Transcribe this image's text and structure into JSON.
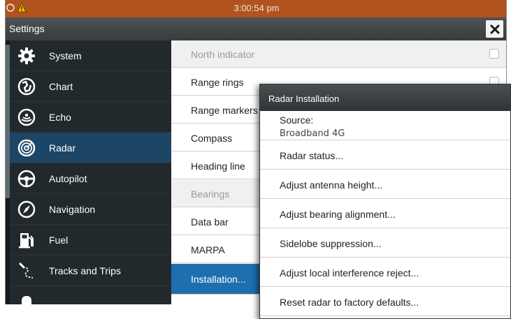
{
  "status_bar": {
    "time": "3:00:54 pm",
    "color": "#b0531f"
  },
  "title_bar": {
    "title": "Settings",
    "close_icon": "close-icon"
  },
  "sidebar": {
    "items": [
      {
        "label": "System",
        "icon": "gear-icon"
      },
      {
        "label": "Chart",
        "icon": "chart-icon"
      },
      {
        "label": "Echo",
        "icon": "echo-icon"
      },
      {
        "label": "Radar",
        "icon": "radar-icon",
        "active": true
      },
      {
        "label": "Autopilot",
        "icon": "autopilot-icon"
      },
      {
        "label": "Navigation",
        "icon": "compass-icon"
      },
      {
        "label": "Fuel",
        "icon": "fuel-icon"
      },
      {
        "label": "Tracks and Trips",
        "icon": "tracks-icon"
      },
      {
        "label": "",
        "icon": "alarms-icon"
      }
    ]
  },
  "options": {
    "items": [
      {
        "label": "North indicator",
        "disabled": true,
        "checkbox": true
      },
      {
        "label": "Range rings"
      },
      {
        "label": "Range markers"
      },
      {
        "label": "Compass"
      },
      {
        "label": "Heading line"
      },
      {
        "label": "Bearings",
        "disabled": true
      },
      {
        "label": "Data bar"
      },
      {
        "label": "MARPA"
      },
      {
        "label": "Installation...",
        "selected": true
      }
    ]
  },
  "dialog": {
    "title": "Radar Installation",
    "source_label": "Source:",
    "source_value": "Broadband 4G",
    "items": [
      "Radar status...",
      "Adjust antenna height...",
      "Adjust bearing alignment...",
      "Sidelobe suppression...",
      "Adjust local interference reject...",
      "Reset radar to factory defaults..."
    ]
  },
  "colors": {
    "sidebar_bg": "#22292d",
    "active_item": "#1d4566",
    "selected_option": "#1e6fb0"
  }
}
